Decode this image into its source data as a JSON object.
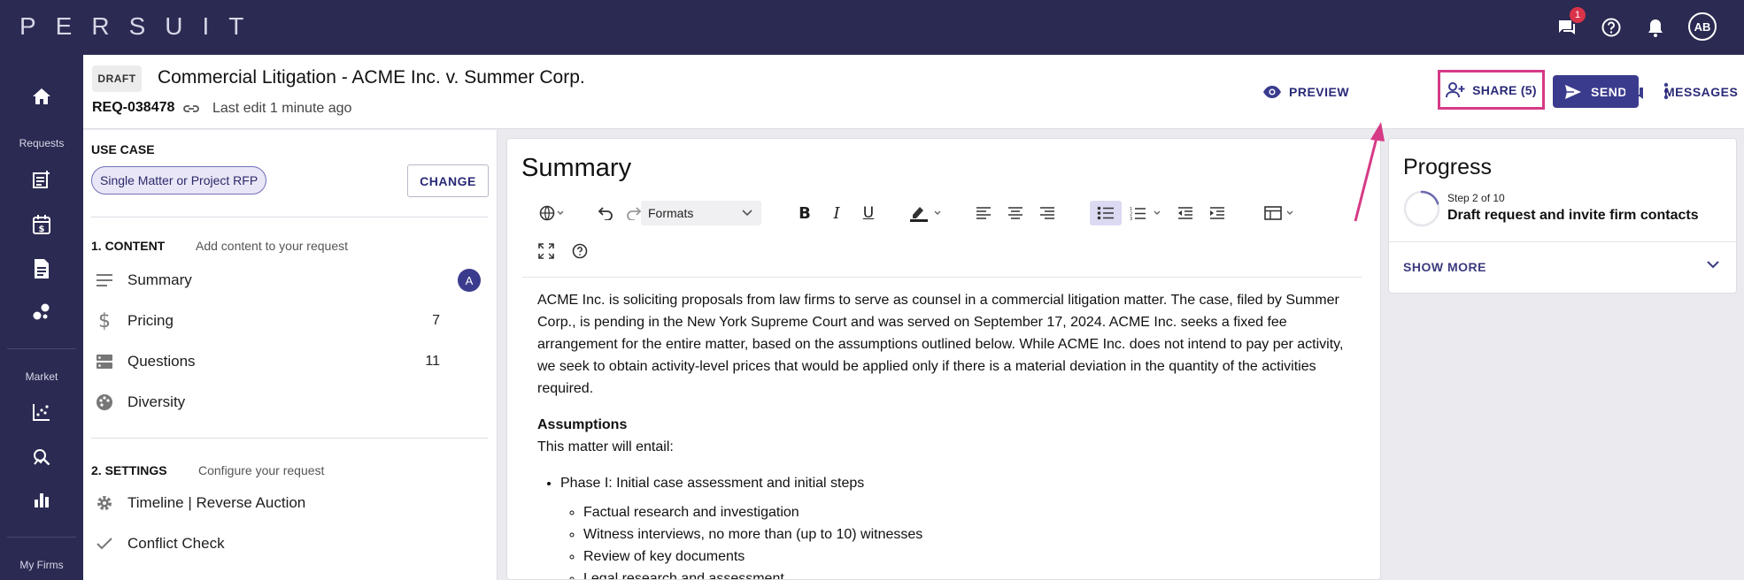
{
  "app": {
    "logo": "PERSUIT",
    "avatar_initials": "AB",
    "messages_badge": "1"
  },
  "sidebar": {
    "sections": [
      "Requests",
      "Market",
      "My Firms"
    ]
  },
  "header": {
    "status_tag": "DRAFT",
    "title": "Commercial Litigation - ACME Inc. v. Summer Corp.",
    "request_id": "REQ-038478",
    "last_edit": "Last edit 1 minute ago",
    "preview_label": "PREVIEW",
    "share_label": "SHARE (5)",
    "send_label": "SEND",
    "messages_label": "MESSAGES"
  },
  "left_panel": {
    "use_case_label": "USE CASE",
    "use_case_value": "Single Matter or Project RFP",
    "change_label": "CHANGE",
    "content_section": {
      "title": "1. CONTENT",
      "subtitle": "Add content to your request",
      "items": [
        {
          "label": "Summary",
          "count": "",
          "avatar": "A",
          "icon": "lines-icon"
        },
        {
          "label": "Pricing",
          "count": "7",
          "avatar": "",
          "icon": "dollar-icon"
        },
        {
          "label": "Questions",
          "count": "11",
          "avatar": "",
          "icon": "list-icon"
        },
        {
          "label": "Diversity",
          "count": "",
          "avatar": "",
          "icon": "palette-icon"
        }
      ]
    },
    "settings_section": {
      "title": "2. SETTINGS",
      "subtitle": "Configure your request",
      "items": [
        {
          "label": "Timeline | Reverse Auction",
          "icon": "gear-icon"
        },
        {
          "label": "Conflict Check",
          "icon": "check-icon"
        }
      ]
    }
  },
  "editor": {
    "title": "Summary",
    "formats_label": "Formats",
    "intro": "ACME Inc. is soliciting proposals from law firms to serve as counsel in a commercial litigation matter. The case, filed by Summer Corp., is pending in the New York Supreme Court and was served on September 17, 2024. ACME Inc. seeks a fixed fee arrangement for the entire matter, based on the assumptions outlined below. While ACME Inc. does not intend to pay per activity, we seek to obtain activity-level prices that would be applied only if there is a material deviation in the quantity of the activities required.",
    "assumptions_heading": "Assumptions",
    "assumptions_lead": "This matter will entail:",
    "phase1": "Phase I: Initial case assessment and initial steps",
    "phase1_items": [
      "Factual research and investigation",
      "Witness interviews, no more than (up to 10) witnesses",
      "Review of key documents",
      "Legal research and assessment"
    ]
  },
  "progress": {
    "title": "Progress",
    "step": "Step 2 of 10",
    "step_fraction": 0.2,
    "description": "Draft request and invite firm contacts",
    "show_more": "SHOW MORE"
  },
  "colors": {
    "nav_bg": "#2a2a52",
    "accent": "#3b3b8e",
    "highlight": "#d63a86"
  }
}
